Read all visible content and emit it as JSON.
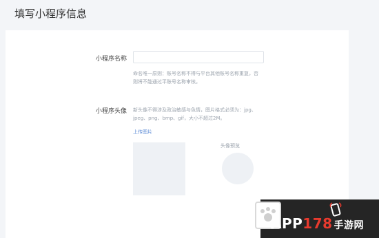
{
  "header": {
    "title": "填写小程序信息"
  },
  "form": {
    "name_label": "小程序名称",
    "name_value": "",
    "name_hint_line1": "命名唯一原则：账号名称不得与平台其他账号名称重复，否",
    "name_hint_line2": "则将不能通过平账号名称审核。",
    "avatar_label": "小程序头像",
    "avatar_hint_line1": "新头像不得涉及政治敏感与色情，图片格式必须为：jpg、",
    "avatar_hint_line2": "jpeg、png、bmp、gif，大小不超过2M。",
    "upload_link": "上传图片",
    "preview_label": "头像预览"
  },
  "watermark": {
    "text_main": "APP",
    "text_num": "178",
    "text_cn": "手游网"
  },
  "colors": {
    "link": "#5c8bd6",
    "hint": "#9ba3ad",
    "background": "#f3f5f8",
    "panel": "#ffffff",
    "watermark_accent": "#e83a2e"
  }
}
